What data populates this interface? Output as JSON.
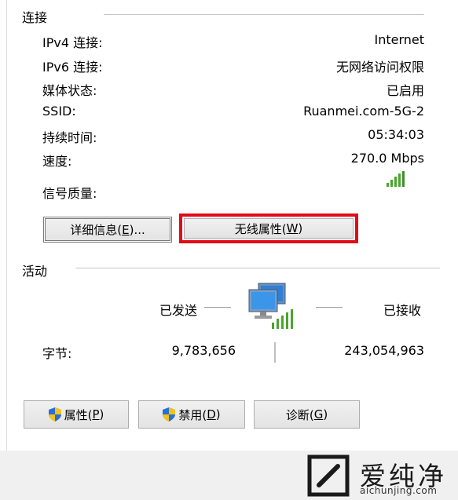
{
  "connection": {
    "section_title": "连接",
    "rows": [
      {
        "label": "IPv4 连接:",
        "value": "Internet"
      },
      {
        "label": "IPv6 连接:",
        "value": "无网络访问权限"
      },
      {
        "label": "媒体状态:",
        "value": "已启用"
      },
      {
        "label": "SSID:",
        "value": "Ruanmei.com-5G-2"
      },
      {
        "label": "持续时间:",
        "value": "05:34:03"
      },
      {
        "label": "速度:",
        "value": "270.0 Mbps"
      }
    ],
    "signal_quality_label": "信号质量:",
    "details_button": {
      "text": "详细信息(",
      "key": "E",
      "suffix": ")..."
    },
    "wireless_props_button": {
      "text": "无线属性(",
      "key": "W",
      "suffix": ")"
    }
  },
  "activity": {
    "section_title": "活动",
    "sent_label": "已发送",
    "received_label": "已接收",
    "bytes_label": "字节:",
    "bytes_sent": "9,783,656",
    "bytes_received": "243,054,963"
  },
  "buttons": {
    "properties": {
      "text": "属性(",
      "key": "P",
      "suffix": ")"
    },
    "disable": {
      "text": "禁用(",
      "key": "D",
      "suffix": ")"
    },
    "diagnose": {
      "text": "诊断(",
      "key": "G",
      "suffix": ")"
    }
  },
  "watermark": {
    "brand_cn": "爱纯净",
    "brand_url": "aichunjing.com"
  },
  "colors": {
    "highlight": "#e20a17",
    "signal": "#49a52e"
  }
}
